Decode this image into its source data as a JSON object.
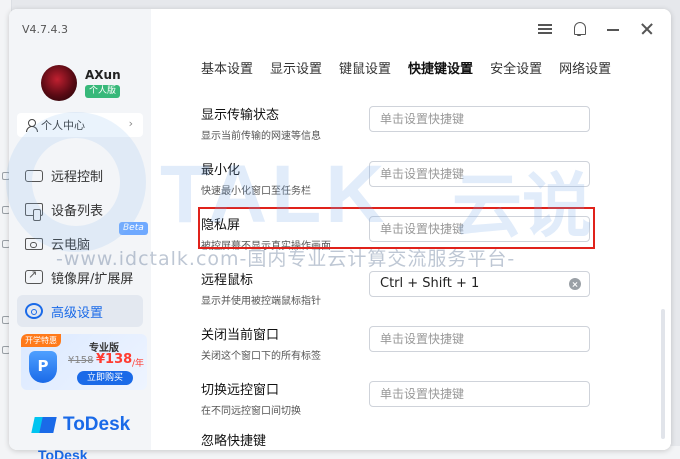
{
  "app": {
    "version": "V4.7.4.3"
  },
  "user": {
    "name": "AXun",
    "edition_badge": "个人版",
    "personal_center_label": "个人中心"
  },
  "sidebar": {
    "items": [
      {
        "label": "远程控制",
        "icon": "remote-control-icon"
      },
      {
        "label": "设备列表",
        "icon": "device-list-icon"
      },
      {
        "label": "云电脑",
        "icon": "cloud-pc-icon",
        "badge": "Beta"
      },
      {
        "label": "镜像屏/扩展屏",
        "icon": "mirror-screen-icon"
      },
      {
        "label": "高级设置",
        "icon": "gear-icon",
        "active": true
      }
    ]
  },
  "promo": {
    "tag": "开学特惠",
    "title": "专业版",
    "shield_letter": "P",
    "old_price": "¥158",
    "new_price": "¥138",
    "unit": "/年",
    "button_label": "立即购买"
  },
  "brand": {
    "name": "ToDesk"
  },
  "tabs": [
    {
      "label": "基本设置",
      "active": false
    },
    {
      "label": "显示设置",
      "active": false
    },
    {
      "label": "键鼠设置",
      "active": false
    },
    {
      "label": "快捷键设置",
      "active": true
    },
    {
      "label": "安全设置",
      "active": false
    },
    {
      "label": "网络设置",
      "active": false
    }
  ],
  "settings": [
    {
      "title": "显示传输状态",
      "desc": "显示当前传输的网速等信息",
      "value": "",
      "placeholder": "单击设置快捷键"
    },
    {
      "title": "最小化",
      "desc": "快速最小化窗口至任务栏",
      "value": "",
      "placeholder": "单击设置快捷键"
    },
    {
      "title": "隐私屏",
      "desc": "被控屏幕不显示真实操作画面",
      "value": "",
      "placeholder": "单击设置快捷键",
      "highlighted": true
    },
    {
      "title": "远程鼠标",
      "desc": "显示并使用被控端鼠标指针",
      "value": "Ctrl + Shift + 1",
      "placeholder": ""
    },
    {
      "title": "关闭当前窗口",
      "desc": "关闭这个窗口下的所有标签",
      "value": "",
      "placeholder": "单击设置快捷键"
    },
    {
      "title": "切换远控窗口",
      "desc": "在不同远控窗口间切换",
      "value": "",
      "placeholder": "单击设置快捷键"
    },
    {
      "title": "忽略快捷键",
      "desc": "",
      "value": "",
      "placeholder": ""
    }
  ],
  "watermark": {
    "big": "TALK",
    "cn": "云说",
    "url": "-www.idctalk.com-国内专业云计算交流服务平台-"
  },
  "background_app": {
    "brand": "ToDesk"
  },
  "colors": {
    "accent": "#1a6ae8",
    "highlight_border": "#e0221b",
    "badge_green": "#37b87a",
    "promo_orange": "#ff7a1a",
    "price_red": "#ff3b30"
  }
}
